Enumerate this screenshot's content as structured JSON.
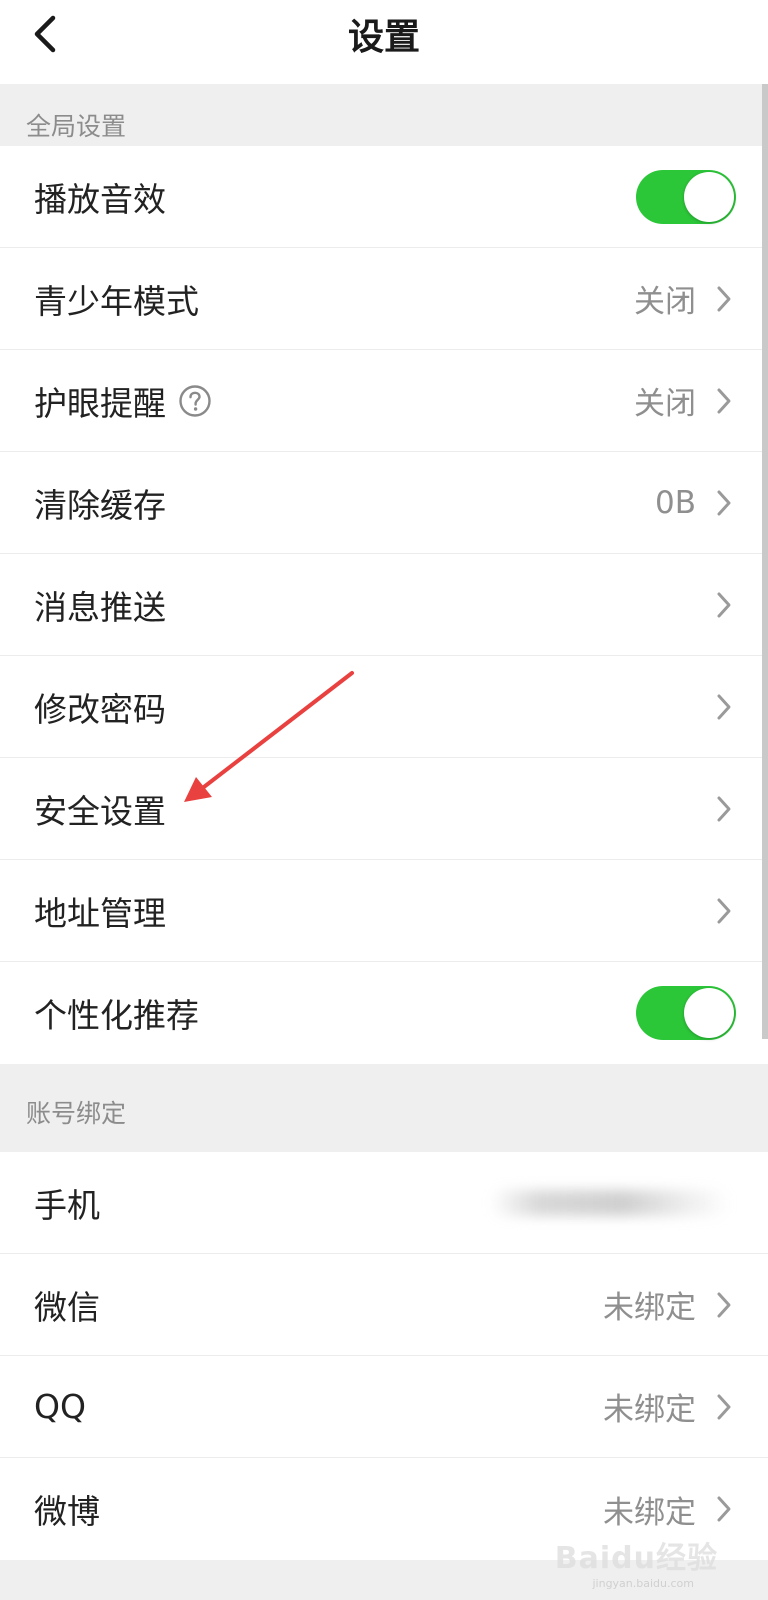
{
  "header": {
    "title": "设置"
  },
  "global_section": {
    "title": "全局设置",
    "items": [
      {
        "label": "播放音效",
        "toggle": true
      },
      {
        "label": "青少年模式",
        "value": "关闭"
      },
      {
        "label": "护眼提醒",
        "value": "关闭"
      },
      {
        "label": "清除缓存",
        "value": "0B"
      },
      {
        "label": "消息推送"
      },
      {
        "label": "修改密码"
      },
      {
        "label": "安全设置"
      },
      {
        "label": "地址管理"
      },
      {
        "label": "个性化推荐",
        "toggle": true
      }
    ]
  },
  "account_section": {
    "title": "账号绑定",
    "items": [
      {
        "label": "手机"
      },
      {
        "label": "微信",
        "value": "未绑定"
      },
      {
        "label": "QQ",
        "value": "未绑定"
      },
      {
        "label": "微博",
        "value": "未绑定"
      }
    ]
  },
  "watermark": {
    "text": "Baidu经验",
    "sub": "jingyan.baidu.com"
  },
  "colors": {
    "toggle_on": "#2cc639",
    "section_bg": "#efefef",
    "annotation_arrow": "#e8413f"
  }
}
